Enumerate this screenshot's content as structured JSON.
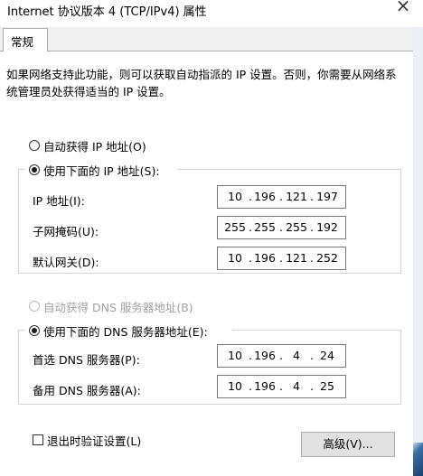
{
  "window": {
    "title": "Internet 协议版本 4 (TCP/IPv4) 属性",
    "close_glyph": "×"
  },
  "tabs": [
    {
      "label": "常规"
    }
  ],
  "description": "如果网络支持此功能，则可以获取自动指派的 IP 设置。否则，你需要从网络系统管理员处获得适当的 IP 设置。",
  "ip_section": {
    "auto_label": "自动获得 IP 地址(O)",
    "manual_label": "使用下面的 IP 地址(S):",
    "selected": "manual",
    "fields": [
      {
        "label": "IP 地址(I):",
        "value": [
          "10",
          "196",
          "121",
          "197"
        ]
      },
      {
        "label": "子网掩码(U):",
        "value": [
          "255",
          "255",
          "255",
          "192"
        ]
      },
      {
        "label": "默认网关(D):",
        "value": [
          "10",
          "196",
          "121",
          "252"
        ]
      }
    ]
  },
  "dns_section": {
    "auto_label": "自动获得 DNS 服务器地址(B)",
    "manual_label": "使用下面的 DNS 服务器地址(E):",
    "selected": "manual",
    "auto_disabled": true,
    "fields": [
      {
        "label": "首选 DNS 服务器(P):",
        "value": [
          "10",
          "196",
          "4",
          "24"
        ]
      },
      {
        "label": "备用 DNS 服务器(A):",
        "value": [
          "10",
          "196",
          "4",
          "25"
        ]
      }
    ]
  },
  "validate_on_exit": {
    "label": "退出时验证设置(L)",
    "checked": false
  },
  "buttons": {
    "advanced": "高级(V)..."
  },
  "ip_separator": "."
}
